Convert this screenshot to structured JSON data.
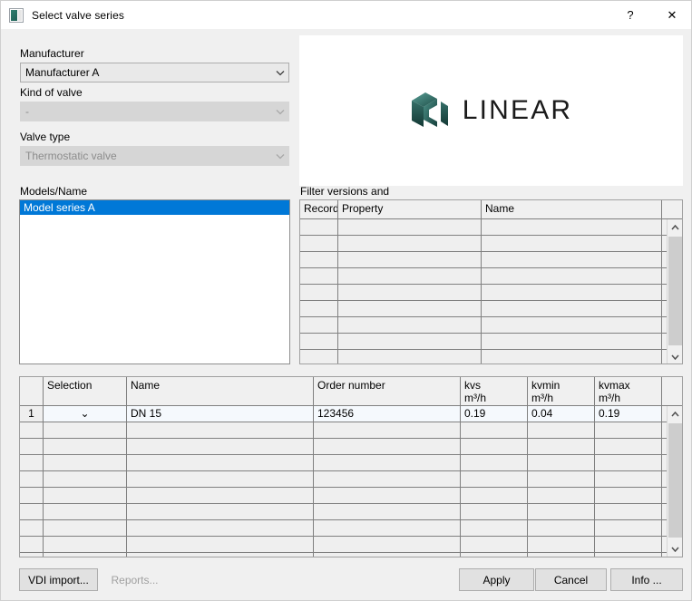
{
  "window": {
    "title": "Select valve series",
    "icon": "valve-series-icon",
    "help_label": "?",
    "close_label": "✕"
  },
  "form": {
    "manufacturer": {
      "label": "Manufacturer",
      "value": "Manufacturer A",
      "enabled": true
    },
    "kind_of_valve": {
      "label": "Kind of valve",
      "value": "-",
      "enabled": false
    },
    "valve_type": {
      "label": "Valve type",
      "value": "Thermostatic valve",
      "enabled": false
    }
  },
  "models": {
    "label": "Models/Name",
    "items": [
      {
        "label": "Model series A",
        "selected": true
      }
    ]
  },
  "logo": {
    "text": "LINEAR",
    "mark_color_dark": "#1d4d49",
    "mark_color_light": "#3c7d76"
  },
  "filter_grid": {
    "label": "Filter versions and",
    "columns": [
      "Record",
      "Property",
      "Name"
    ],
    "rows": [],
    "empty_row_count": 9
  },
  "data_grid": {
    "columns": [
      {
        "name": "",
        "unit": ""
      },
      {
        "name": "Selection",
        "unit": ""
      },
      {
        "name": "Name",
        "unit": ""
      },
      {
        "name": "Order number",
        "unit": ""
      },
      {
        "name": "kvs",
        "unit": "m³/h"
      },
      {
        "name": "kvmin",
        "unit": "m³/h"
      },
      {
        "name": "kvmax",
        "unit": "m³/h"
      }
    ],
    "rows": [
      {
        "number": "1",
        "selection": "⌄",
        "name": "DN 15",
        "order_number": "123456",
        "kvs": "0.19",
        "kvmin": "0.04",
        "kvmax": "0.19"
      }
    ],
    "empty_row_count": 9
  },
  "buttons": {
    "vdi_import": {
      "label": "VDI import...",
      "enabled": true
    },
    "reports": {
      "label": "Reports...",
      "enabled": false
    },
    "apply": {
      "label": "Apply",
      "enabled": true
    },
    "cancel": {
      "label": "Cancel",
      "enabled": true
    },
    "info": {
      "label": "Info ...",
      "enabled": true
    }
  },
  "colors": {
    "selection_blue": "#0078d7",
    "window_bg": "#f0f0f0",
    "grid_line": "#808080"
  }
}
